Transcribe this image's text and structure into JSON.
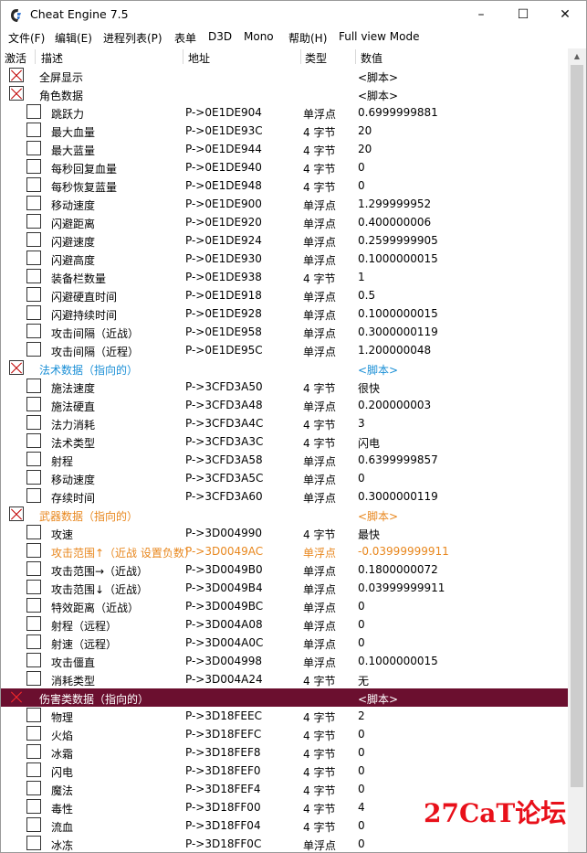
{
  "window": {
    "title": "Cheat Engine 7.5",
    "controls": [
      "–",
      "☐",
      "✕"
    ]
  },
  "menu": [
    "文件(F)",
    "编辑(E)",
    "进程列表(P)",
    "表单",
    "D3D",
    "Mono",
    "帮助(H)",
    "Full view Mode"
  ],
  "columns": {
    "active": "激活",
    "desc": "描述",
    "address": "地址",
    "type": "类型",
    "value": "数值"
  },
  "colors": {
    "blue_group": "#1a8fd6",
    "orange_group": "#e8871e",
    "orange_row": "#e8871e",
    "selected_bg": "#6b0f2f"
  },
  "rows": [
    {
      "kind": "group",
      "desc": "全屏显示",
      "address": "",
      "type": "",
      "value": "<脚本>",
      "color": "",
      "sel": false,
      "checked": true
    },
    {
      "kind": "group",
      "desc": "角色数据",
      "address": "",
      "type": "",
      "value": "<脚本>",
      "color": "",
      "sel": false,
      "checked": true
    },
    {
      "kind": "child",
      "desc": "跳跃力",
      "address": "P->0E1DE904",
      "type": "单浮点",
      "value": "0.6999999881",
      "color": "",
      "sel": false,
      "checked": false
    },
    {
      "kind": "child",
      "desc": "最大血量",
      "address": "P->0E1DE93C",
      "type": "4 字节",
      "value": "20",
      "color": "",
      "sel": false,
      "checked": false
    },
    {
      "kind": "child",
      "desc": "最大蓝量",
      "address": "P->0E1DE944",
      "type": "4 字节",
      "value": "20",
      "color": "",
      "sel": false,
      "checked": false
    },
    {
      "kind": "child",
      "desc": "每秒回复血量",
      "address": "P->0E1DE940",
      "type": "4 字节",
      "value": "0",
      "color": "",
      "sel": false,
      "checked": false
    },
    {
      "kind": "child",
      "desc": "每秒恢复蓝量",
      "address": "P->0E1DE948",
      "type": "4 字节",
      "value": "0",
      "color": "",
      "sel": false,
      "checked": false
    },
    {
      "kind": "child",
      "desc": "移动速度",
      "address": "P->0E1DE900",
      "type": "单浮点",
      "value": "1.299999952",
      "color": "",
      "sel": false,
      "checked": false
    },
    {
      "kind": "child",
      "desc": "闪避距离",
      "address": "P->0E1DE920",
      "type": "单浮点",
      "value": "0.400000006",
      "color": "",
      "sel": false,
      "checked": false
    },
    {
      "kind": "child",
      "desc": "闪避速度",
      "address": "P->0E1DE924",
      "type": "单浮点",
      "value": "0.2599999905",
      "color": "",
      "sel": false,
      "checked": false
    },
    {
      "kind": "child",
      "desc": "闪避高度",
      "address": "P->0E1DE930",
      "type": "单浮点",
      "value": "0.1000000015",
      "color": "",
      "sel": false,
      "checked": false
    },
    {
      "kind": "child",
      "desc": "装备栏数量",
      "address": "P->0E1DE938",
      "type": "4 字节",
      "value": "1",
      "color": "",
      "sel": false,
      "checked": false
    },
    {
      "kind": "child",
      "desc": "闪避硬直时间",
      "address": "P->0E1DE918",
      "type": "单浮点",
      "value": "0.5",
      "color": "",
      "sel": false,
      "checked": false
    },
    {
      "kind": "child",
      "desc": "闪避持续时间",
      "address": "P->0E1DE928",
      "type": "单浮点",
      "value": "0.1000000015",
      "color": "",
      "sel": false,
      "checked": false
    },
    {
      "kind": "child",
      "desc": "攻击间隔（近战）",
      "address": "P->0E1DE958",
      "type": "单浮点",
      "value": "0.3000000119",
      "color": "",
      "sel": false,
      "checked": false
    },
    {
      "kind": "child",
      "desc": "攻击间隔（近程）",
      "address": "P->0E1DE95C",
      "type": "单浮点",
      "value": "1.200000048",
      "color": "",
      "sel": false,
      "checked": false
    },
    {
      "kind": "group",
      "desc": "法术数据（指向的）",
      "address": "",
      "type": "",
      "value": "<脚本>",
      "color": "#1a8fd6",
      "sel": false,
      "checked": true
    },
    {
      "kind": "child",
      "desc": "施法速度",
      "address": "P->3CFD3A50",
      "type": "4 字节",
      "value": "很快",
      "color": "",
      "sel": false,
      "checked": false
    },
    {
      "kind": "child",
      "desc": "施法硬直",
      "address": "P->3CFD3A48",
      "type": "单浮点",
      "value": "0.200000003",
      "color": "",
      "sel": false,
      "checked": false
    },
    {
      "kind": "child",
      "desc": "法力消耗",
      "address": "P->3CFD3A4C",
      "type": "4 字节",
      "value": "3",
      "color": "",
      "sel": false,
      "checked": false
    },
    {
      "kind": "child",
      "desc": "法术类型",
      "address": "P->3CFD3A3C",
      "type": "4 字节",
      "value": "闪电",
      "color": "",
      "sel": false,
      "checked": false
    },
    {
      "kind": "child",
      "desc": "射程",
      "address": "P->3CFD3A58",
      "type": "单浮点",
      "value": "0.6399999857",
      "color": "",
      "sel": false,
      "checked": false
    },
    {
      "kind": "child",
      "desc": "移动速度",
      "address": "P->3CFD3A5C",
      "type": "单浮点",
      "value": "0",
      "color": "",
      "sel": false,
      "checked": false
    },
    {
      "kind": "child",
      "desc": "存续时间",
      "address": "P->3CFD3A60",
      "type": "单浮点",
      "value": "0.3000000119",
      "color": "",
      "sel": false,
      "checked": false
    },
    {
      "kind": "group",
      "desc": "武器数据（指向的）",
      "address": "",
      "type": "",
      "value": "<脚本>",
      "color": "#e8871e",
      "sel": false,
      "checked": true
    },
    {
      "kind": "child",
      "desc": "攻速",
      "address": "P->3D004990",
      "type": "4 字节",
      "value": "最快",
      "color": "",
      "sel": false,
      "checked": false
    },
    {
      "kind": "child",
      "desc": "攻击范围↑（近战 设置负数）",
      "address": "P->3D0049AC",
      "type": "单浮点",
      "value": "-0.03999999911",
      "color": "#e8871e",
      "sel": false,
      "checked": false
    },
    {
      "kind": "child",
      "desc": "攻击范围→（近战）",
      "address": "P->3D0049B0",
      "type": "单浮点",
      "value": "0.1800000072",
      "color": "",
      "sel": false,
      "checked": false
    },
    {
      "kind": "child",
      "desc": "攻击范围↓（近战）",
      "address": "P->3D0049B4",
      "type": "单浮点",
      "value": "0.03999999911",
      "color": "",
      "sel": false,
      "checked": false
    },
    {
      "kind": "child",
      "desc": "特效距离（近战）",
      "address": "P->3D0049BC",
      "type": "单浮点",
      "value": "0",
      "color": "",
      "sel": false,
      "checked": false
    },
    {
      "kind": "child",
      "desc": "射程（远程）",
      "address": "P->3D004A08",
      "type": "单浮点",
      "value": "0",
      "color": "",
      "sel": false,
      "checked": false
    },
    {
      "kind": "child",
      "desc": "射速（远程）",
      "address": "P->3D004A0C",
      "type": "单浮点",
      "value": "0",
      "color": "",
      "sel": false,
      "checked": false
    },
    {
      "kind": "child",
      "desc": "攻击僵直",
      "address": "P->3D004998",
      "type": "单浮点",
      "value": "0.1000000015",
      "color": "",
      "sel": false,
      "checked": false
    },
    {
      "kind": "child",
      "desc": "消耗类型",
      "address": "P->3D004A24",
      "type": "4 字节",
      "value": "无",
      "color": "",
      "sel": false,
      "checked": false
    },
    {
      "kind": "group",
      "desc": "伤害类数据（指向的）",
      "address": "",
      "type": "",
      "value": "<脚本>",
      "color": "",
      "sel": true,
      "checked": true
    },
    {
      "kind": "child",
      "desc": "物理",
      "address": "P->3D18FEEC",
      "type": "4 字节",
      "value": "2",
      "color": "",
      "sel": false,
      "checked": false
    },
    {
      "kind": "child",
      "desc": "火焰",
      "address": "P->3D18FEFC",
      "type": "4 字节",
      "value": "0",
      "color": "",
      "sel": false,
      "checked": false
    },
    {
      "kind": "child",
      "desc": "冰霜",
      "address": "P->3D18FEF8",
      "type": "4 字节",
      "value": "0",
      "color": "",
      "sel": false,
      "checked": false
    },
    {
      "kind": "child",
      "desc": "闪电",
      "address": "P->3D18FEF0",
      "type": "4 字节",
      "value": "0",
      "color": "",
      "sel": false,
      "checked": false
    },
    {
      "kind": "child",
      "desc": "魔法",
      "address": "P->3D18FEF4",
      "type": "4 字节",
      "value": "0",
      "color": "",
      "sel": false,
      "checked": false
    },
    {
      "kind": "child",
      "desc": "毒性",
      "address": "P->3D18FF00",
      "type": "4 字节",
      "value": "4",
      "color": "",
      "sel": false,
      "checked": false
    },
    {
      "kind": "child",
      "desc": "流血",
      "address": "P->3D18FF04",
      "type": "4 字节",
      "value": "0",
      "color": "",
      "sel": false,
      "checked": false
    },
    {
      "kind": "child",
      "desc": "冰冻",
      "address": "P->3D18FF0C",
      "type": "单浮点",
      "value": "0",
      "color": "",
      "sel": false,
      "checked": false
    }
  ],
  "watermark": "27CaT论坛"
}
